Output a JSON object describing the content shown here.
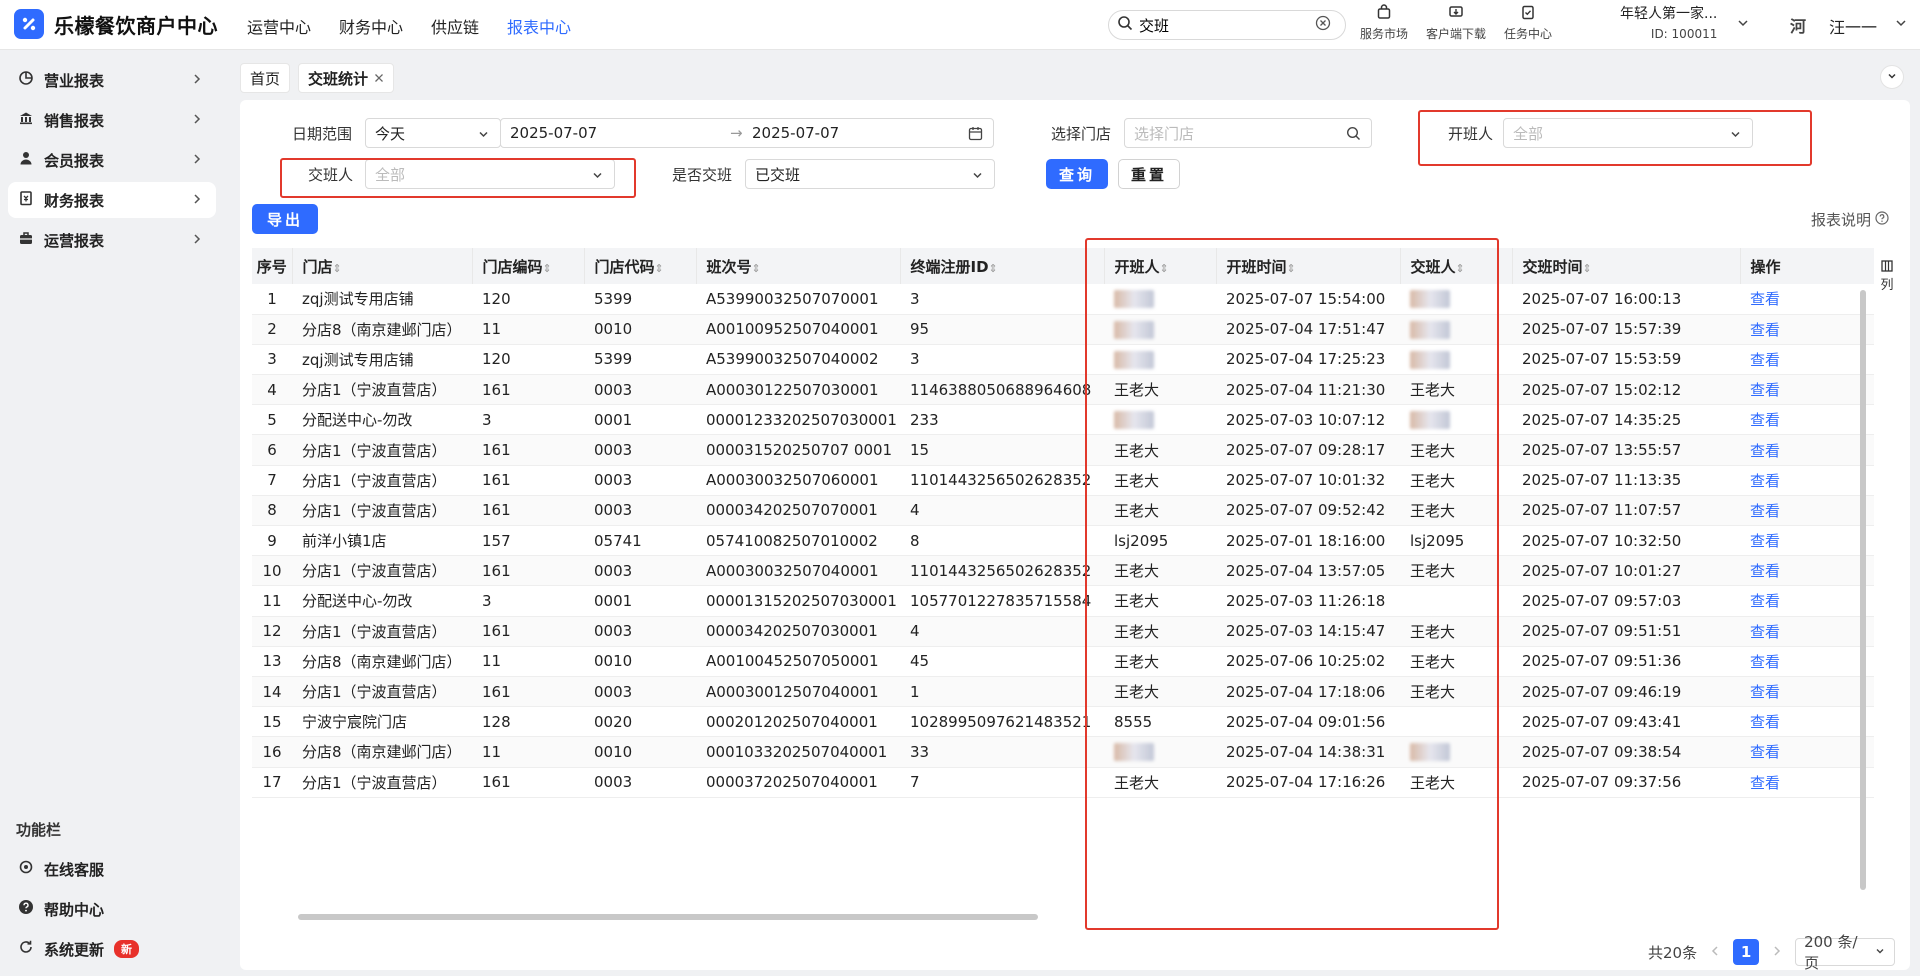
{
  "header": {
    "title": "乐檬餐饮商户中心",
    "nav": [
      "运营中心",
      "财务中心",
      "供应链",
      "报表中心"
    ],
    "active_nav": "报表中心",
    "search_value": "交班",
    "tools": [
      "服务市场",
      "客户端下载",
      "任务中心"
    ],
    "account_name": "年轻人第一家...",
    "account_id": "ID: 100011",
    "avatar_text": "河",
    "username": "汪一一"
  },
  "sidebar": {
    "items": [
      {
        "label": "营业报表",
        "icon": "chart-icon"
      },
      {
        "label": "销售报表",
        "icon": "bank-icon"
      },
      {
        "label": "会员报表",
        "icon": "user-icon"
      },
      {
        "label": "财务报表",
        "icon": "receipt-icon"
      },
      {
        "label": "运营报表",
        "icon": "briefcase-icon"
      }
    ],
    "active": "财务报表",
    "section_title": "功能栏",
    "bottom_items": [
      {
        "label": "在线客服",
        "icon": "headset-icon"
      },
      {
        "label": "帮助中心",
        "icon": "help-icon"
      },
      {
        "label": "系统更新",
        "icon": "refresh-icon",
        "badge": "新"
      }
    ]
  },
  "tabs": [
    {
      "label": "首页"
    },
    {
      "label": "交班统计",
      "closable": true
    }
  ],
  "filters": {
    "date_label": "日期范围",
    "date_preset": "今天",
    "date_start": "2025-07-07",
    "date_end": "2025-07-07",
    "store_label": "选择门店",
    "store_placeholder": "选择门店",
    "opener_label": "开班人",
    "opener_value": "全部",
    "handover_label": "交班人",
    "handover_value": "全部",
    "handed_label": "是否交班",
    "handed_value": "已交班",
    "query_btn": "查询",
    "reset_btn": "重置",
    "export_btn": "导出",
    "report_help": "报表说明"
  },
  "table": {
    "columns": [
      "序号",
      "门店",
      "门店编码",
      "门店代码",
      "班次号",
      "终端注册ID",
      "开班人",
      "开班时间",
      "交班人",
      "交班时间",
      "操作"
    ],
    "rows": [
      [
        "1",
        "zqj测试专用店铺",
        "120",
        "5399",
        "A53990032507070001",
        "3",
        "",
        "2025-07-07 15:54:00",
        "",
        "2025-07-07 16:00:13",
        "查看"
      ],
      [
        "2",
        "分店8（南京建邺门店）",
        "11",
        "0010",
        "A00100952507040001",
        "95",
        "",
        "2025-07-04 17:51:47",
        "",
        "2025-07-07 15:57:39",
        "查看"
      ],
      [
        "3",
        "zqj测试专用店铺",
        "120",
        "5399",
        "A53990032507040002",
        "3",
        "",
        "2025-07-04 17:25:23",
        "",
        "2025-07-07 15:53:59",
        "查看"
      ],
      [
        "4",
        "分店1（宁波直营店）",
        "161",
        "0003",
        "A00030122507030001",
        "1146388050688964608",
        "王老大",
        "2025-07-04 11:21:30",
        "王老大",
        "2025-07-07 15:02:12",
        "查看"
      ],
      [
        "5",
        "分配送中心-勿改",
        "3",
        "0001",
        "00001233202507030001",
        "233",
        "",
        "2025-07-03 10:07:12",
        "",
        "2025-07-07 14:35:25",
        "查看"
      ],
      [
        "6",
        "分店1（宁波直营店）",
        "161",
        "0003",
        "000031520250707 0001",
        "15",
        "王老大",
        "2025-07-07 09:28:17",
        "王老大",
        "2025-07-07 13:55:57",
        "查看"
      ],
      [
        "7",
        "分店1（宁波直营店）",
        "161",
        "0003",
        "A00030032507060001",
        "1101443256502628352",
        "王老大",
        "2025-07-07 10:01:32",
        "王老大",
        "2025-07-07 11:13:35",
        "查看"
      ],
      [
        "8",
        "分店1（宁波直营店）",
        "161",
        "0003",
        "000034202507070001",
        "4",
        "王老大",
        "2025-07-07 09:52:42",
        "王老大",
        "2025-07-07 11:07:57",
        "查看"
      ],
      [
        "9",
        "前洋小镇1店",
        "157",
        "05741",
        "057410082507010002",
        "8",
        "lsj2095",
        "2025-07-01 18:16:00",
        "lsj2095",
        "2025-07-07 10:32:50",
        "查看"
      ],
      [
        "10",
        "分店1（宁波直营店）",
        "161",
        "0003",
        "A00030032507040001",
        "1101443256502628352",
        "王老大",
        "2025-07-04 13:57:05",
        "王老大",
        "2025-07-07 10:01:27",
        "查看"
      ],
      [
        "11",
        "分配送中心-勿改",
        "3",
        "0001",
        "00001315202507030001",
        "1057701227835715584",
        "王老大",
        "2025-07-03 11:26:18",
        "",
        "2025-07-07 09:57:03",
        "查看"
      ],
      [
        "12",
        "分店1（宁波直营店）",
        "161",
        "0003",
        "000034202507030001",
        "4",
        "王老大",
        "2025-07-03 14:15:47",
        "王老大",
        "2025-07-07 09:51:51",
        "查看"
      ],
      [
        "13",
        "分店8（南京建邺门店）",
        "11",
        "0010",
        "A00100452507050001",
        "45",
        "王老大",
        "2025-07-06 10:25:02",
        "王老大",
        "2025-07-07 09:51:36",
        "查看"
      ],
      [
        "14",
        "分店1（宁波直营店）",
        "161",
        "0003",
        "A00030012507040001",
        "1",
        "王老大",
        "2025-07-04 17:18:06",
        "王老大",
        "2025-07-07 09:46:19",
        "查看"
      ],
      [
        "15",
        "宁波宁宸院门店",
        "128",
        "0020",
        "000201202507040001",
        "1028995097621483521",
        "8555",
        "2025-07-04 09:01:56",
        "",
        "2025-07-07 09:43:41",
        "查看"
      ],
      [
        "16",
        "分店8（南京建邺门店）",
        "11",
        "0010",
        "0001033202507040001",
        "33",
        "",
        "2025-07-04 14:38:31",
        "",
        "2025-07-07 09:38:54",
        "查看"
      ],
      [
        "17",
        "分店1（宁波直营店）",
        "161",
        "0003",
        "000037202507040001",
        "7",
        "王老大",
        "2025-07-04 17:16:26",
        "王老大",
        "2025-07-07 09:37:56",
        "查看"
      ]
    ],
    "blurred_opener_rows": [
      1,
      2,
      3,
      5,
      16
    ],
    "blurred_handover_rows": [
      1,
      2,
      3,
      5,
      16
    ],
    "column_setting_label": "列"
  },
  "pagination": {
    "total": "共20条",
    "current": "1",
    "page_size": "200 条/页"
  },
  "colors": {
    "primary": "#2f6bff",
    "highlight_box": "#e2392c",
    "badge": "#e8312a"
  }
}
